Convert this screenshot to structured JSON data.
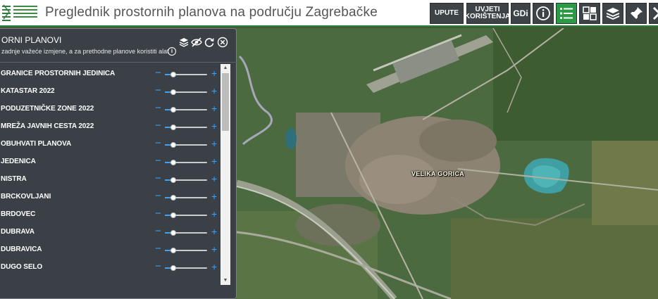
{
  "header": {
    "title": "Preglednik prostornih planova na području Zagrebačke",
    "buttons": [
      {
        "name": "upute-button",
        "label": "UPUTE"
      },
      {
        "name": "uvjeti-koristenja-button",
        "label_line1": "UVJETI",
        "label_line2": "KORIŠTENJA"
      },
      {
        "name": "gdi-button",
        "label": "GDi"
      }
    ],
    "icon_buttons": [
      "info-icon",
      "layer-list-icon",
      "basemap-gallery-icon",
      "layers-stack-icon",
      "pin-icon",
      "tools-icon"
    ]
  },
  "panel": {
    "title": "ORNI PLANOVI",
    "subtitle": "zadnje važeće izmjene, a za prethodne planove koristiti alat",
    "info_glyph": "i",
    "icons": [
      "layers-icon",
      "visibility-off-icon",
      "refresh-icon",
      "close-icon"
    ],
    "layers": [
      {
        "name": "GRANICE PROSTORNIH JEDINICA",
        "opacity": 0.2
      },
      {
        "name": "KATASTAR 2022",
        "opacity": 0.2
      },
      {
        "name": "PODUZETNIČKE ZONE 2022",
        "opacity": 0.2
      },
      {
        "name": "MREŽA JAVNIH CESTA 2022",
        "opacity": 0.2
      },
      {
        "name": "OBUHVATI PLANOVA",
        "opacity": 0.2
      },
      {
        "name": "JEDENICA",
        "opacity": 0.2
      },
      {
        "name": "NISTRA",
        "opacity": 0.2
      },
      {
        "name": "BRCKOVLJANI",
        "opacity": 0.2
      },
      {
        "name": "BRDOVEC",
        "opacity": 0.2
      },
      {
        "name": "DUBRAVA",
        "opacity": 0.2
      },
      {
        "name": "DUBRAVICA",
        "opacity": 0.2
      },
      {
        "name": "DUGO SELO",
        "opacity": 0.2
      }
    ],
    "minus_glyph": "−",
    "plus_glyph": "+"
  },
  "map": {
    "city_label": "VELIKA GORICA"
  },
  "colors": {
    "header_button_bg": "#3d4347",
    "active_button_bg": "#2b9a45",
    "panel_bg": "#3a4046",
    "slider_accent": "#35a3ff"
  }
}
